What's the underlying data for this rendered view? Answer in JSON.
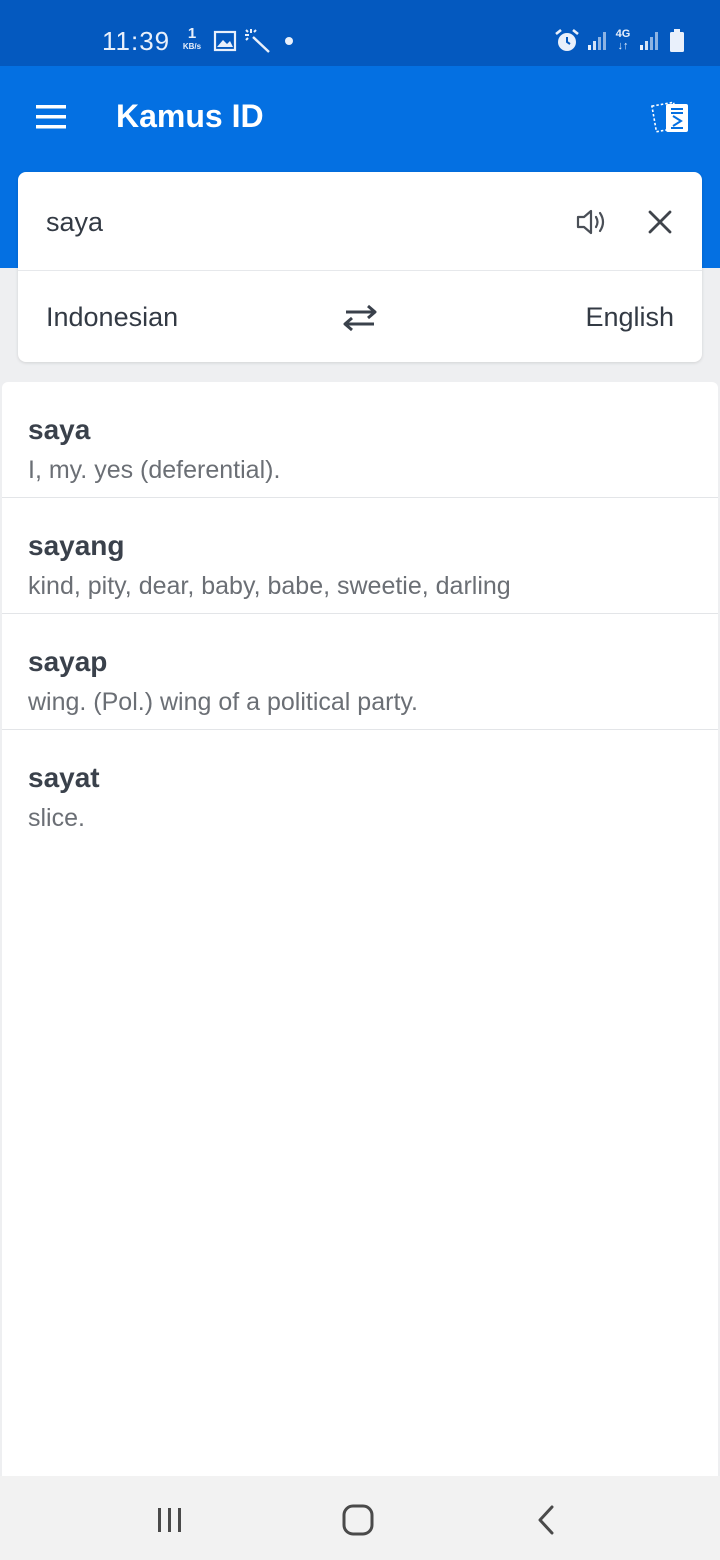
{
  "status_bar": {
    "time": "11:39",
    "net_speed_value": "1",
    "net_speed_unit": "KB/s",
    "network_label": "4G",
    "icons": [
      "image-icon",
      "magic-wand-icon",
      "dot-icon",
      "alarm-icon",
      "signal-icon",
      "4g-icon",
      "signal-icon",
      "battery-icon"
    ]
  },
  "app_bar": {
    "title": "Kamus ID",
    "icons": [
      "menu-icon",
      "translate-document-icon"
    ]
  },
  "search": {
    "value": "saya",
    "source_language": "Indonesian",
    "target_language": "English",
    "icons": [
      "speaker-icon",
      "close-icon",
      "swap-icon"
    ]
  },
  "results": [
    {
      "word": "saya",
      "definition": "I, my. yes (deferential)."
    },
    {
      "word": "sayang",
      "definition": "kind, pity, dear, baby, babe, sweetie, darling"
    },
    {
      "word": "sayap",
      "definition": "wing. (Pol.) wing of a political party."
    },
    {
      "word": "sayat",
      "definition": "slice."
    }
  ],
  "nav_bar": {
    "icons": [
      "recents-icon",
      "home-icon",
      "back-icon"
    ]
  },
  "colors": {
    "status_bar": "#0459bf",
    "app_bar": "#0470e2",
    "background": "#eeeff1",
    "card": "#ffffff"
  }
}
